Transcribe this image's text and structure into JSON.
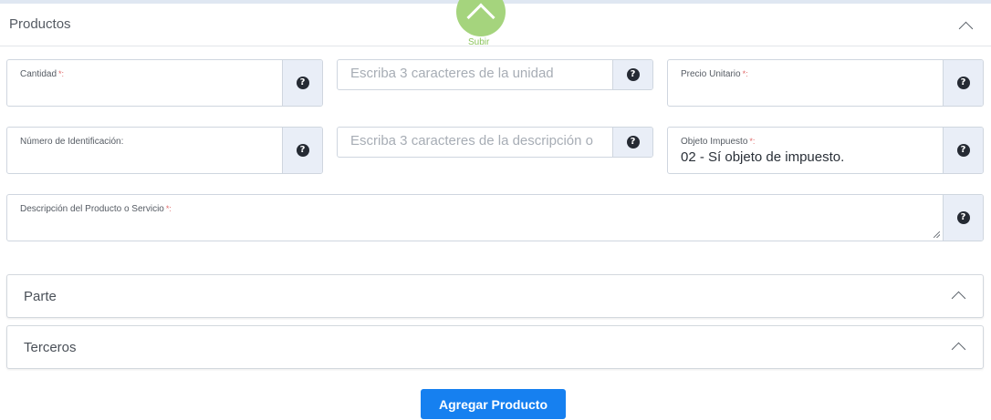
{
  "panel": {
    "title": "Productos"
  },
  "scroll_top": {
    "label": "Subir",
    "icon": "chevron-up-icon"
  },
  "fields": {
    "cantidad": {
      "label": "Cantidad",
      "required_mark": "*:"
    },
    "unidad": {
      "placeholder": "Escriba 3 caracteres de la unidad"
    },
    "precio_unitario": {
      "label": "Precio Unitario",
      "required_mark": "*:"
    },
    "numero_identificacion": {
      "label": "Número de Identificación:"
    },
    "descripcion_busqueda": {
      "placeholder": "Escriba 3 caracteres de la descripción o"
    },
    "objeto_impuesto": {
      "label": "Objeto Impuesto",
      "required_mark": "*:",
      "value": "02 - Sí objeto de impuesto."
    },
    "descripcion_producto": {
      "label": "Descripción del Producto o Servicio",
      "required_mark": "*:"
    }
  },
  "help_icon": "question-circle-icon",
  "sections": [
    {
      "title": "Parte"
    },
    {
      "title": "Terceros"
    }
  ],
  "actions": {
    "add_product": "Agregar Producto"
  },
  "colors": {
    "accent": "#1680f0",
    "scroll_top": "#a5d47d",
    "help_bg": "#e9eef7"
  }
}
